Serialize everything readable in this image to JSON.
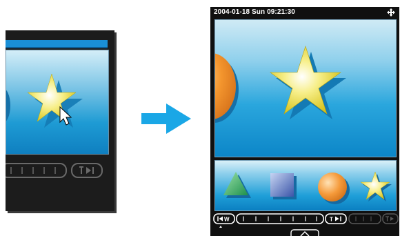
{
  "status_bar": {
    "datetime": "2004-01-18 Sun 09:21:30"
  },
  "icons": {
    "move": "four-way-arrow-icon",
    "transition_arrow": "right-arrow-icon",
    "cursor": "mouse-pointer-icon"
  },
  "thumbnails": [
    {
      "shape": "triangle",
      "color": "#3bb36a"
    },
    {
      "shape": "square",
      "color": "#6d86c6"
    },
    {
      "shape": "sphere",
      "color": "#f29a3a"
    },
    {
      "shape": "star",
      "color": "#f2e23a"
    }
  ],
  "controls": {
    "wide_button": "W",
    "tele_button": "T"
  },
  "colors": {
    "accent": "#1aa7e6",
    "device_body": "#101010",
    "screen_bottom": "#0c86c8"
  }
}
